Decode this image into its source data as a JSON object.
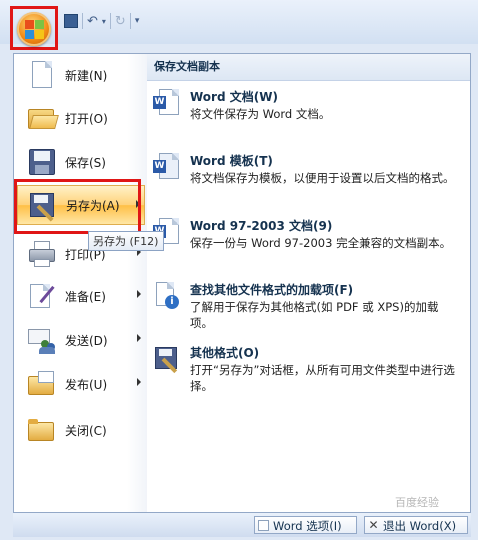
{
  "menu": {
    "items": [
      {
        "label": "新建(N)",
        "icon": "new-document-icon",
        "has_submenu": false
      },
      {
        "label": "打开(O)",
        "icon": "open-folder-icon",
        "has_submenu": false
      },
      {
        "label": "保存(S)",
        "icon": "save-disk-icon",
        "has_submenu": false
      },
      {
        "label": "另存为(A)",
        "icon": "save-as-icon",
        "has_submenu": true,
        "active": true
      },
      {
        "label": "打印(P)",
        "icon": "printer-icon",
        "has_submenu": true
      },
      {
        "label": "准备(E)",
        "icon": "prepare-pen-icon",
        "has_submenu": true
      },
      {
        "label": "发送(D)",
        "icon": "send-icon",
        "has_submenu": true
      },
      {
        "label": "发布(U)",
        "icon": "publish-folder-icon",
        "has_submenu": true
      },
      {
        "label": "关闭(C)",
        "icon": "close-folder-icon",
        "has_submenu": false
      }
    ],
    "tooltip": "另存为 (F12)"
  },
  "save_copy": {
    "header": "保存文档副本",
    "options": [
      {
        "title": "Word 文档(W)",
        "desc": "将文件保存为 Word 文档。",
        "icon": "word-document-icon"
      },
      {
        "title": "Word 模板(T)",
        "desc": "将文档保存为模板，以便用于设置以后文档的格式。",
        "icon": "word-template-icon"
      },
      {
        "title": "Word 97-2003 文档(9)",
        "desc": "保存一份与 Word 97-2003 完全兼容的文档副本。",
        "icon": "word-97-document-icon"
      },
      {
        "title": "查找其他文件格式的加载项(F)",
        "desc": "了解用于保存为其他格式(如 PDF 或 XPS)的加载项。",
        "icon": "addin-info-icon"
      },
      {
        "title": "其他格式(O)",
        "desc": "打开“另存为”对话框，从所有可用文件类型中进行选择。",
        "icon": "other-formats-icon"
      }
    ]
  },
  "bottom": {
    "options_label": "Word 选项(I)",
    "exit_label": "退出 Word(X)"
  },
  "watermark": "百度经验"
}
